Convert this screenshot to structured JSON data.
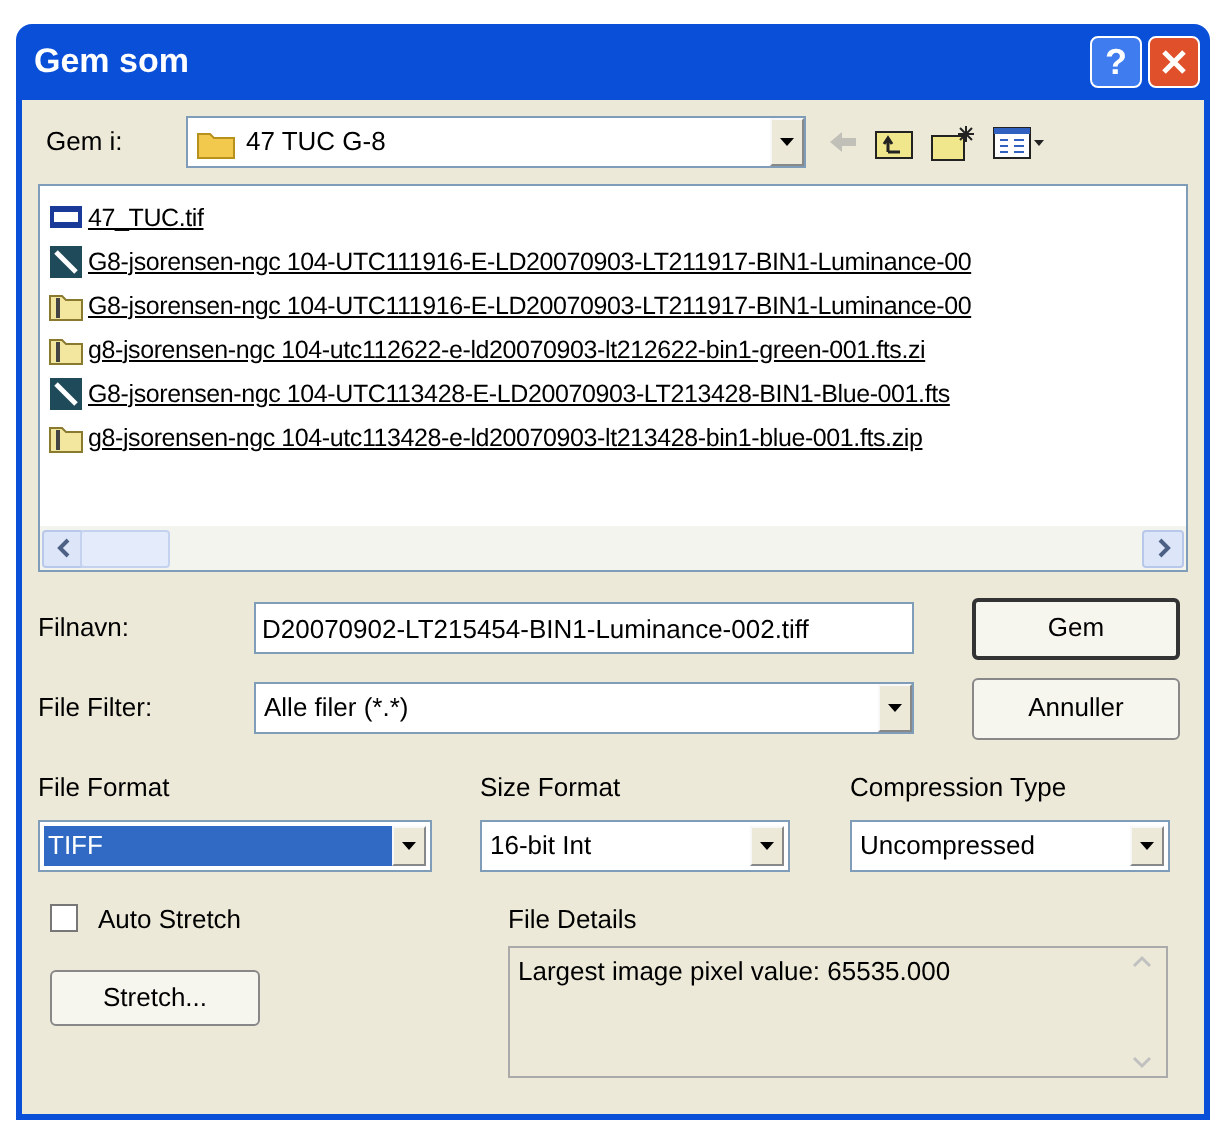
{
  "window": {
    "title": "Gem som",
    "help_label": "?"
  },
  "location": {
    "label": "Gem i:",
    "value": "47 TUC G-8"
  },
  "toolbar": [
    {
      "kind": "back",
      "disabled": true
    },
    {
      "kind": "up",
      "disabled": false
    },
    {
      "kind": "new_folder",
      "disabled": false
    },
    {
      "kind": "views",
      "disabled": false
    }
  ],
  "files": [
    {
      "kind": "tif",
      "name": "47_TUC.tif"
    },
    {
      "kind": "fits",
      "name": "G8-jsorensen-ngc 104-UTC111916-E-LD20070903-LT211917-BIN1-Luminance-00"
    },
    {
      "kind": "zip",
      "name": "G8-jsorensen-ngc 104-UTC111916-E-LD20070903-LT211917-BIN1-Luminance-00"
    },
    {
      "kind": "zip",
      "name": "g8-jsorensen-ngc 104-utc112622-e-ld20070903-lt212622-bin1-green-001.fts.zi"
    },
    {
      "kind": "fits",
      "name": "G8-jsorensen-ngc 104-UTC113428-E-LD20070903-LT213428-BIN1-Blue-001.fts"
    },
    {
      "kind": "zip",
      "name": "g8-jsorensen-ngc 104-utc113428-e-ld20070903-lt213428-bin1-blue-001.fts.zip"
    }
  ],
  "file_name": {
    "label": "Filnavn:",
    "value": "D20070902-LT215454-BIN1-Luminance-002.tiff"
  },
  "file_filter": {
    "label": "File Filter:",
    "value": "Alle filer (*.*)"
  },
  "buttons": [
    {
      "label": "Gem",
      "default": true
    },
    {
      "label": "Annuller",
      "default": false
    }
  ],
  "formats": [
    {
      "label": "File Format",
      "value": "TIFF",
      "focused": true
    },
    {
      "label": "Size Format",
      "value": "16-bit Int",
      "focused": false
    },
    {
      "label": "Compression Type",
      "value": "Uncompressed",
      "focused": false
    }
  ],
  "auto_stretch": {
    "label": "Auto Stretch",
    "checked": false
  },
  "stretch_button": "Stretch...",
  "file_details": {
    "label": "File Details",
    "text": "Largest image pixel value: 65535.000"
  }
}
